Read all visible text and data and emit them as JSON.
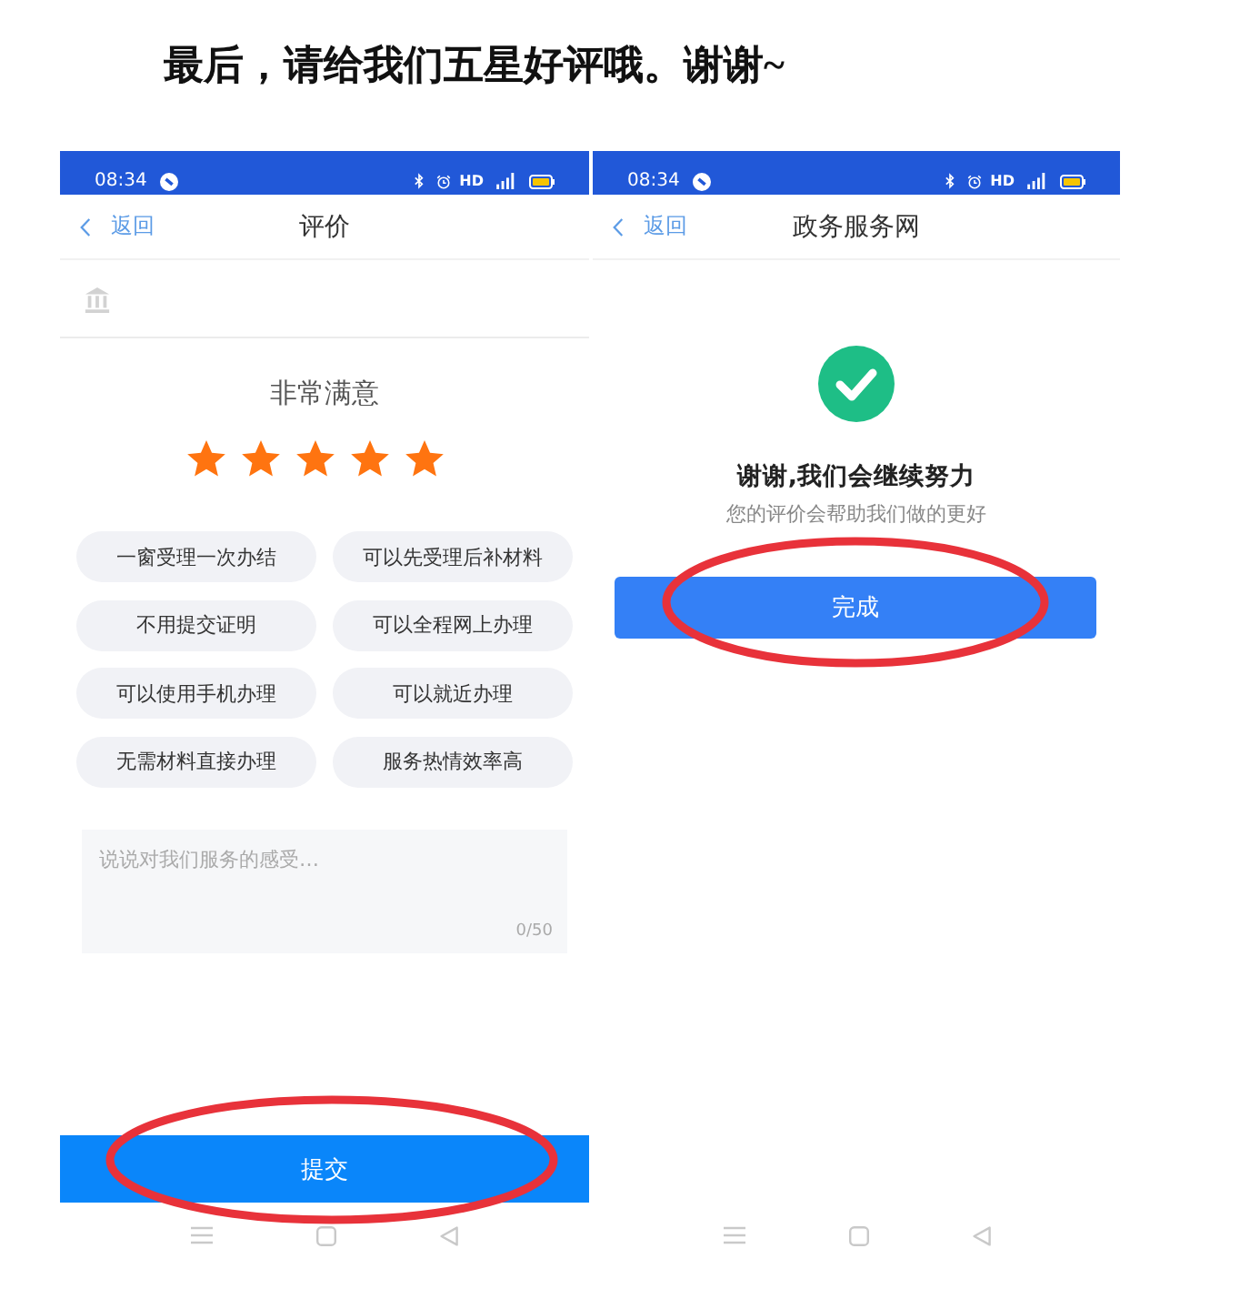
{
  "heading": "最后，请给我们五星好评哦。谢谢~",
  "screens": [
    {
      "kind": "rating",
      "status_bar": {
        "time": "08:34",
        "network": "HD"
      },
      "nav": {
        "back": "返回",
        "title": "评价"
      },
      "rating": {
        "label": "非常满意",
        "stars": 5
      },
      "tags": [
        {
          "label": "一窗受理一次办结",
          "selected": false
        },
        {
          "label": "可以先受理后补材料",
          "selected": false
        },
        {
          "label": "不用提交证明",
          "selected": false
        },
        {
          "label": "可以全程网上办理",
          "selected": false
        },
        {
          "label": "可以使用手机办理",
          "selected": false
        },
        {
          "label": "可以就近办理",
          "selected": false
        },
        {
          "label": "无需材料直接办理",
          "selected": false
        },
        {
          "label": "服务热情效率高",
          "selected": false
        }
      ],
      "comment": {
        "placeholder": "说说对我们服务的感受…",
        "counter": "0/50"
      },
      "submit": {
        "label": "提交",
        "circled": true
      }
    },
    {
      "kind": "success",
      "status_bar": {
        "time": "08:34",
        "network": "HD"
      },
      "nav": {
        "back": "返回",
        "title": "政务服务网"
      },
      "message": {
        "title": "谢谢,我们会继续努力",
        "subtitle": "您的评价会帮助我们做的更好"
      },
      "done": {
        "label": "完成",
        "circled": true
      }
    }
  ]
}
